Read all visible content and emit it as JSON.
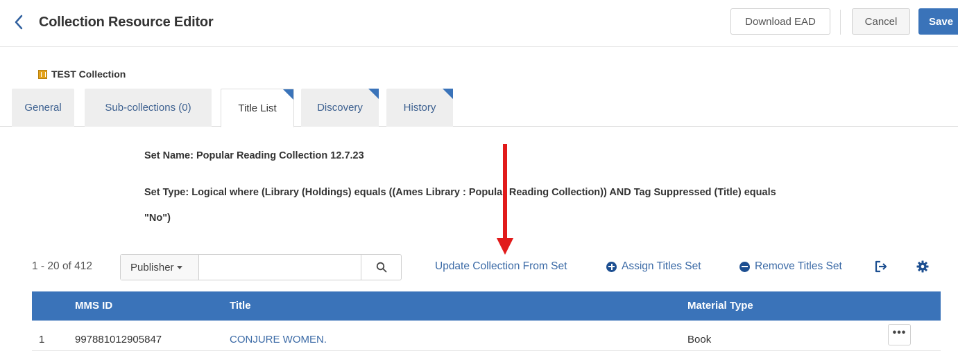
{
  "header": {
    "title": "Collection Resource Editor",
    "back_icon": "chevron-left-icon",
    "download_label": "Download EAD",
    "cancel_label": "Cancel",
    "save_label": "Save"
  },
  "collection": {
    "name": "TEST Collection",
    "icon": "collection-icon"
  },
  "tabs": [
    {
      "label": "General",
      "active": false,
      "has_indicator": false
    },
    {
      "label": "Sub-collections (0)",
      "active": false,
      "has_indicator": false
    },
    {
      "label": "Title List",
      "active": true,
      "has_indicator": true
    },
    {
      "label": "Discovery",
      "active": false,
      "has_indicator": true
    },
    {
      "label": "History",
      "active": false,
      "has_indicator": true
    }
  ],
  "set_info": {
    "name": "Set Name: Popular Reading Collection 12.7.23",
    "type_line1": "Set Type: Logical where (Library (Holdings) equals ((Ames Library : Popular Reading Collection)) AND Tag Suppressed (Title) equals",
    "type_line2": "\"No\")"
  },
  "toolbar": {
    "count": "1 - 20 of 412",
    "search_field": "Publisher",
    "search_value": "",
    "search_placeholder": "",
    "update_label": "Update Collection From Set",
    "assign_label": "Assign Titles Set",
    "remove_label": "Remove Titles Set"
  },
  "table": {
    "columns": [
      "MMS ID",
      "Title",
      "Material Type"
    ],
    "rows": [
      {
        "index": "1",
        "mms_id": "997881012905847",
        "title": "CONJURE WOMEN.",
        "material_type": "Book",
        "actions": "•••"
      }
    ]
  },
  "colors": {
    "primary": "#3a73b9",
    "link": "#3b6aa6",
    "annotation_arrow": "#e11a1a",
    "collection_icon": "#e3a21a"
  }
}
